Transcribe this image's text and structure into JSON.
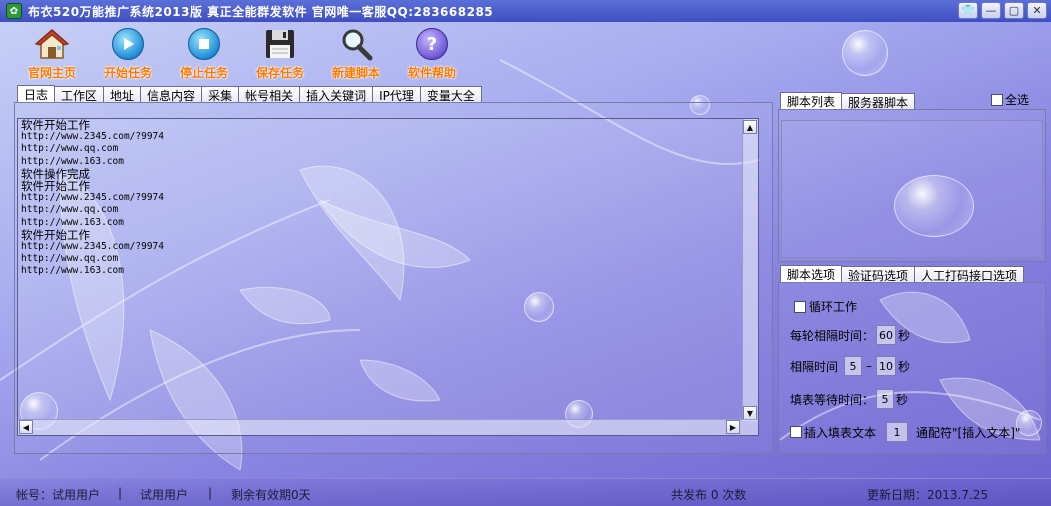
{
  "window": {
    "title": "布衣520万能推广系统2013版 真正全能群发软件 官网唯一客服QQ:283668285",
    "controls": [
      "skin",
      "minimize",
      "maximize",
      "close"
    ]
  },
  "toolbar": {
    "items": [
      {
        "label": "官网主页",
        "icon": "house-icon"
      },
      {
        "label": "开始任务",
        "icon": "play-icon"
      },
      {
        "label": "停止任务",
        "icon": "stop-icon"
      },
      {
        "label": "保存任务",
        "icon": "floppy-disk-icon"
      },
      {
        "label": "新建脚本",
        "icon": "magnifier-icon"
      },
      {
        "label": "软件帮助",
        "icon": "help-icon"
      }
    ]
  },
  "main_tabs": [
    "日志",
    "工作区",
    "地址",
    "信息内容",
    "采集",
    "帐号相关",
    "插入关键词",
    "IP代理",
    "变量大全"
  ],
  "log": {
    "lines": [
      "软件开始工作",
      "http://www.2345.com/?9974",
      "http://www.qq.com",
      "http://www.163.com",
      "软件操作完成",
      "软件开始工作",
      "http://www.2345.com/?9974",
      "http://www.qq.com",
      "http://www.163.com",
      "软件开始工作",
      "http://www.2345.com/?9974",
      "http://www.qq.com",
      "http://www.163.com"
    ]
  },
  "script_tabs": [
    "脚本列表",
    "服务器脚本"
  ],
  "select_all_label": "全选",
  "options_tabs": [
    "脚本选项",
    "验证码选项",
    "人工打码接口选项"
  ],
  "options": {
    "loop_label": "循环工作",
    "round_interval_label": "每轮相隔时间：",
    "round_interval_value": "60",
    "round_interval_unit": "秒",
    "interval_label": "相隔时间",
    "interval_min": "5",
    "interval_dash": "–",
    "interval_max": "10",
    "interval_unit": "秒",
    "fill_wait_label": "填表等待时间：",
    "fill_wait_value": "5",
    "fill_wait_unit": "秒",
    "insert_text_label": "插入填表文本",
    "insert_text_value": "1",
    "wildcard_label": "通配符\"[插入文本]\""
  },
  "status": {
    "account": "帐号：试用用户",
    "sep1": "|",
    "user": "试用用户",
    "sep2": "|",
    "remaining": "剩余有效期0天",
    "published": "共发布 0 次数",
    "update_date": "更新日期：2013.7.25"
  }
}
